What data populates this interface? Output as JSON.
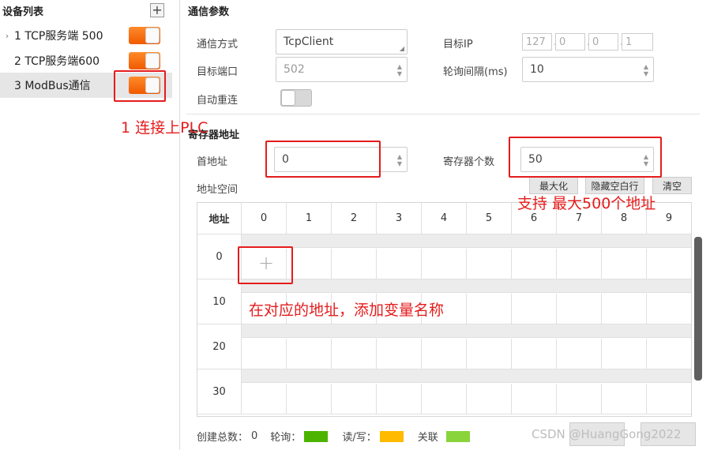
{
  "left_panel": {
    "title": "设备列表",
    "add_icon": "+",
    "devices": [
      {
        "label": "1 TCP服务端 500",
        "expanded_caret": "›"
      },
      {
        "label": "2 TCP服务端600"
      },
      {
        "label": "3 ModBus通信"
      }
    ]
  },
  "comm": {
    "title": "通信参数",
    "mode_label": "通信方式",
    "mode_value": "TcpClient",
    "ip_label": "目标IP",
    "ip_segments": [
      "127",
      "0",
      "0",
      "1"
    ],
    "port_label": "目标端口",
    "port_value": "502",
    "poll_label": "轮询间隔(ms)",
    "poll_value": "10",
    "reconnect_label": "自动重连"
  },
  "register": {
    "title": "寄存器地址",
    "start_label": "首地址",
    "start_value": "0",
    "count_label": "寄存器个数",
    "count_value": "50",
    "space_label": "地址空间",
    "btn_max": "最大化",
    "btn_hide": "隐藏空白行",
    "btn_clear": "清空"
  },
  "grid": {
    "header_addr": "地址",
    "columns": [
      "0",
      "1",
      "2",
      "3",
      "4",
      "5",
      "6",
      "7",
      "8",
      "9"
    ],
    "rows": [
      "0",
      "10",
      "20",
      "30"
    ],
    "add_symbol": "+"
  },
  "status": {
    "created_total_label": "创建总数：",
    "created_total_value": "0",
    "poll_legend": "轮询：",
    "rw_legend": "读/写：",
    "link_legend": "关联",
    "poll_color": "#4cb400",
    "rw_color": "#ffbb00",
    "link_color": "#88d43a"
  },
  "watermark": "CSDN @HuangGong2022",
  "annotations": {
    "connect_plc": "1  连接上PLC",
    "max_500": "支持 最大500个地址",
    "add_var": "在对应的地址，添加变量名称"
  },
  "colors": {
    "accent": "#f26a0f",
    "annotation": "#e51c1c"
  }
}
